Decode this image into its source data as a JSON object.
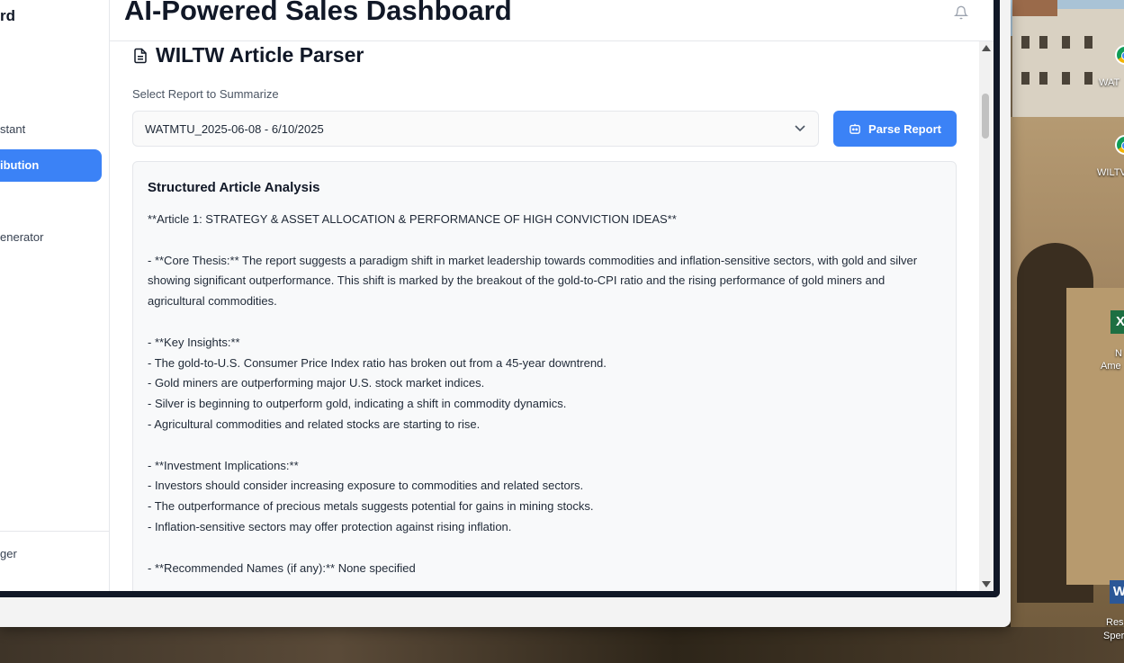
{
  "sidebar": {
    "brand": "rd",
    "items": [
      {
        "label": "stant"
      },
      {
        "label": "ibution",
        "active": true
      },
      {
        "label": "enerator"
      },
      {
        "label": "ger"
      }
    ]
  },
  "header": {
    "title": "AI-Powered Sales Dashboard",
    "bell_icon": "bell-icon"
  },
  "main": {
    "section_title": "WILTW Article Parser",
    "select_label": "Select Report to Summarize",
    "select_value": "WATMTU_2025-06-08 - 6/10/2025",
    "parse_button": "Parse Report",
    "analysis": {
      "title": "Structured Article Analysis",
      "lines": [
        "**Article 1: STRATEGY & ASSET ALLOCATION & PERFORMANCE OF HIGH CONVICTION IDEAS**",
        "",
        "- **Core Thesis:** The report suggests a paradigm shift in market leadership towards commodities and inflation-sensitive sectors, with gold and silver showing significant outperformance. This shift is marked by the breakout of the gold-to-CPI ratio and the rising performance of gold miners and agricultural commodities.",
        "",
        "- **Key Insights:**",
        "- The gold-to-U.S. Consumer Price Index ratio has broken out from a 45-year downtrend.",
        "- Gold miners are outperforming major U.S. stock market indices.",
        "- Silver is beginning to outperform gold, indicating a shift in commodity dynamics.",
        "- Agricultural commodities and related stocks are starting to rise.",
        "",
        "- **Investment Implications:**",
        "- Investors should consider increasing exposure to commodities and related sectors.",
        "- The outperformance of precious metals suggests potential for gains in mining stocks.",
        "- Inflation-sensitive sectors may offer protection against rising inflation.",
        "",
        "- **Recommended Names (if any):** None specified"
      ]
    }
  },
  "desktop_icons": [
    {
      "label": "WAT",
      "type": "chrome"
    },
    {
      "label": "WILTV",
      "type": "chrome"
    },
    {
      "label": "N",
      "sub": "Ame",
      "type": "excel"
    },
    {
      "label": "Res",
      "sub": "Sper",
      "type": "word"
    }
  ]
}
